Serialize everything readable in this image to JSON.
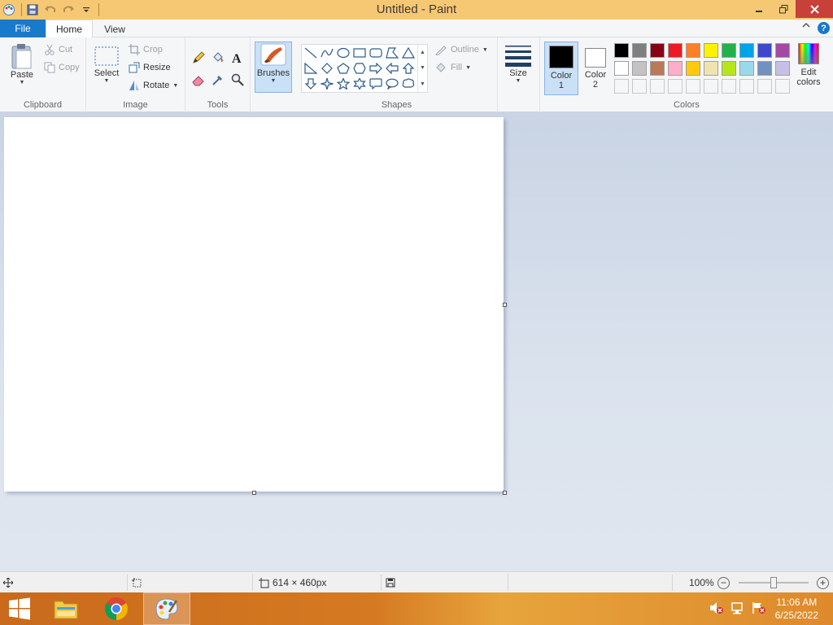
{
  "window": {
    "title": "Untitled - Paint"
  },
  "tabs": {
    "file": "File",
    "home": "Home",
    "view": "View"
  },
  "ribbon": {
    "clipboard": {
      "label": "Clipboard",
      "paste": "Paste",
      "cut": "Cut",
      "copy": "Copy"
    },
    "image": {
      "label": "Image",
      "select": "Select",
      "crop": "Crop",
      "resize": "Resize",
      "rotate": "Rotate"
    },
    "tools": {
      "label": "Tools"
    },
    "brushes": {
      "label": "Brushes"
    },
    "shapes": {
      "label": "Shapes",
      "outline": "Outline",
      "fill": "Fill",
      "size": "Size"
    },
    "colors": {
      "label": "Colors",
      "color1_line1": "Color",
      "color1_line2": "1",
      "color2_line1": "Color",
      "color2_line2": "2",
      "edit_line1": "Edit",
      "edit_line2": "colors",
      "color1_value": "#000000",
      "color2_value": "#ffffff",
      "palette": [
        "#000000",
        "#7f7f7f",
        "#880015",
        "#ed1c24",
        "#ff7f27",
        "#fff200",
        "#22b14c",
        "#00a2e8",
        "#3f48cc",
        "#a349a4",
        "#ffffff",
        "#c3c3c3",
        "#b97a57",
        "#ffaec9",
        "#ffc90e",
        "#efe4b0",
        "#b5e61d",
        "#99d9ea",
        "#7092be",
        "#c8bfe7",
        "#f5f6f7",
        "#f5f6f7",
        "#f5f6f7",
        "#f5f6f7",
        "#f5f6f7",
        "#f5f6f7",
        "#f5f6f7",
        "#f5f6f7",
        "#f5f6f7",
        "#f5f6f7"
      ]
    }
  },
  "status": {
    "dimensions": "614 × 460px",
    "zoom": "100%",
    "zoom_level": 1.0
  },
  "taskbar": {
    "time": "11:06 AM",
    "date": "6/25/2022"
  }
}
